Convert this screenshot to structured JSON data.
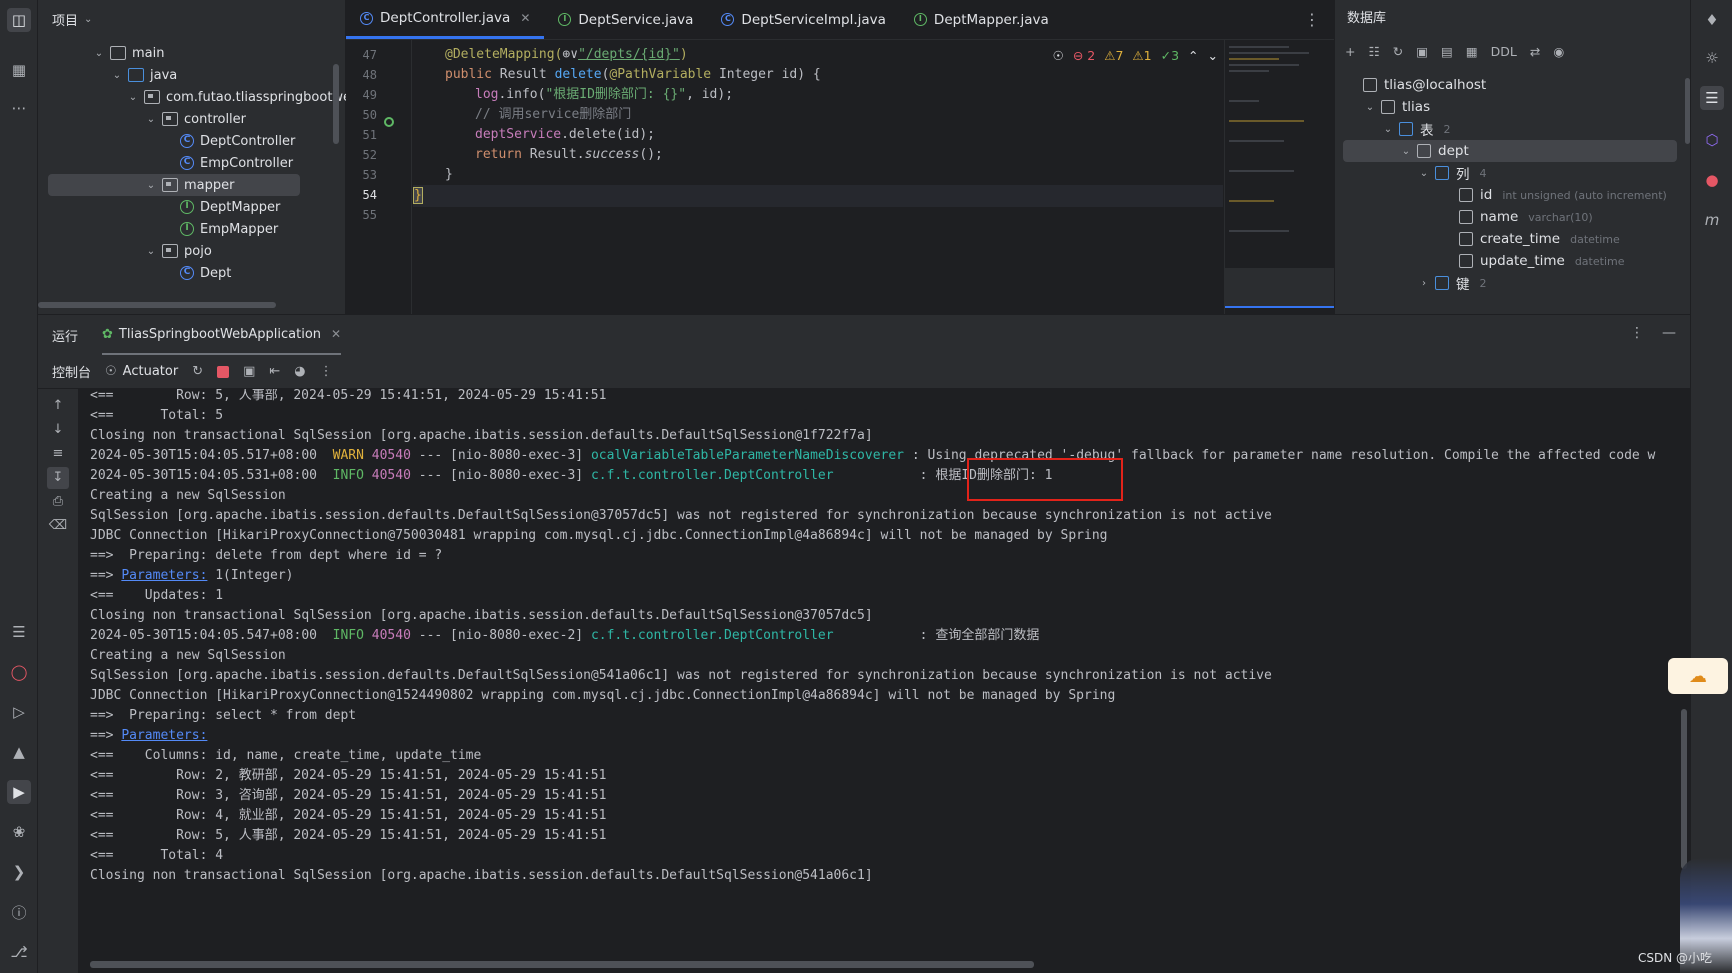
{
  "project": {
    "title": "项目",
    "tree": [
      {
        "label": "main",
        "depth": 0,
        "kind": "folder",
        "expanded": true
      },
      {
        "label": "java",
        "depth": 1,
        "kind": "folder-blue",
        "expanded": true
      },
      {
        "label": "com.futao.tliasspringbootwe",
        "depth": 2,
        "kind": "package",
        "expanded": true
      },
      {
        "label": "controller",
        "depth": 3,
        "kind": "package",
        "expanded": true
      },
      {
        "label": "DeptController",
        "depth": 4,
        "kind": "class"
      },
      {
        "label": "EmpController",
        "depth": 4,
        "kind": "class"
      },
      {
        "label": "mapper",
        "depth": 3,
        "kind": "package",
        "expanded": true,
        "selected": true
      },
      {
        "label": "DeptMapper",
        "depth": 4,
        "kind": "interface"
      },
      {
        "label": "EmpMapper",
        "depth": 4,
        "kind": "interface"
      },
      {
        "label": "pojo",
        "depth": 3,
        "kind": "package",
        "expanded": true
      },
      {
        "label": "Dept",
        "depth": 4,
        "kind": "class"
      }
    ]
  },
  "editor": {
    "tabs": [
      {
        "label": "DeptController.java",
        "kind": "class",
        "active": true
      },
      {
        "label": "DeptService.java",
        "kind": "interface"
      },
      {
        "label": "DeptServiceImpl.java",
        "kind": "class"
      },
      {
        "label": "DeptMapper.java",
        "kind": "interface"
      }
    ],
    "inspections": {
      "errors": "2",
      "warnings": "7",
      "weak_warnings": "1",
      "ok": "3"
    },
    "line_numbers": [
      "47",
      "48",
      "49",
      "50",
      "51",
      "52",
      "53",
      "54",
      "55"
    ],
    "code": {
      "l47_ann": "@DeleteMapping(",
      "l47_globe": "⊕∨",
      "l47_str": "\"/depts/{id}\"",
      "l47_end": ")",
      "l48_kw": "public ",
      "l48_type": "Result ",
      "l48_fn": "delete",
      "l48_open": "(",
      "l48_ann": "@PathVariable ",
      "l48_rest": "Integer id) {",
      "l49_field": "log",
      "l49_call": ".info(",
      "l49_str": "\"根据ID删除部门: {}\"",
      "l49_rest": ", id);",
      "l50_cmt": "// 调用service删除部门",
      "l51_field": "deptService",
      "l51_rest": ".delete(id);",
      "l52_kw": "return ",
      "l52_type": "Result.",
      "l52_ital": "success",
      "l52_rest": "();",
      "l53": "}",
      "l54": "}"
    }
  },
  "database": {
    "title": "数据库",
    "toolbar": [
      "+",
      "☷",
      "↻",
      "▣",
      "▤",
      "▦",
      "DDL",
      "⇄",
      "◉"
    ],
    "tree": [
      {
        "label": "tlias@localhost",
        "depth": 0
      },
      {
        "label": "tlias",
        "depth": 1,
        "expanded": true
      },
      {
        "label": "表",
        "depth": 2,
        "count": "2",
        "expanded": true
      },
      {
        "label": "dept",
        "depth": 3,
        "expanded": true,
        "selected": true
      },
      {
        "label": "列",
        "depth": 4,
        "count": "4",
        "expanded": true
      },
      {
        "label": "id",
        "depth": 5,
        "type": "int unsigned (auto increment)"
      },
      {
        "label": "name",
        "depth": 5,
        "type": "varchar(10)"
      },
      {
        "label": "create_time",
        "depth": 5,
        "type": "datetime"
      },
      {
        "label": "update_time",
        "depth": 5,
        "type": "datetime"
      },
      {
        "label": "键",
        "depth": 4,
        "count": "2",
        "expanded": false
      }
    ]
  },
  "run": {
    "title": "运行",
    "config": "TliasSpringbootWebApplication",
    "console_tab": "控制台",
    "actuator_tab": "Actuator"
  },
  "console": {
    "l1": "<==        Row: 5, 人事部, 2024-05-29 15:41:51, 2024-05-29 15:41:51",
    "l2": "<==      Total: 5",
    "l3": "Closing non transactional SqlSession [org.apache.ibatis.session.defaults.DefaultSqlSession@1f722f7a]",
    "l4_ts": "2024-05-30T15:04:05.517+08:00  ",
    "l4_level": "WARN ",
    "l4_pid": "40540",
    "l4_mid": " --- [nio-8080-exec-3] ",
    "l4_logger": "ocalVariableTableParameterNameDiscoverer",
    "l4_msg": " : Using deprecated '-debug' fallback for parameter name resolution. Compile the affected code w",
    "l5_ts": "2024-05-30T15:04:05.531+08:00  ",
    "l5_level": "INFO ",
    "l5_pid": "40540",
    "l5_mid": " --- [nio-8080-exec-3] ",
    "l5_logger": "c.f.t.controller.DeptController          ",
    "l5_msg": " : 根据ID删除部门: 1",
    "l6": "Creating a new SqlSession",
    "l7": "SqlSession [org.apache.ibatis.session.defaults.DefaultSqlSession@37057dc5] was not registered for synchronization because synchronization is not active",
    "l8": "JDBC Connection [HikariProxyConnection@750030481 wrapping com.mysql.cj.jdbc.ConnectionImpl@4a86894c] will not be managed by Spring",
    "l9": "==>  Preparing: delete from dept where id = ?",
    "l10_pre": "==> ",
    "l10_link": "Parameters:",
    "l10_rest": " 1(Integer)",
    "l11": "<==    Updates: 1",
    "l12": "Closing non transactional SqlSession [org.apache.ibatis.session.defaults.DefaultSqlSession@37057dc5]",
    "l13_ts": "2024-05-30T15:04:05.547+08:00  ",
    "l13_level": "INFO ",
    "l13_pid": "40540",
    "l13_mid": " --- [nio-8080-exec-2] ",
    "l13_logger": "c.f.t.controller.DeptController          ",
    "l13_msg": " : 查询全部部门数据",
    "l14": "Creating a new SqlSession",
    "l15": "SqlSession [org.apache.ibatis.session.defaults.DefaultSqlSession@541a06c1] was not registered for synchronization because synchronization is not active",
    "l16": "JDBC Connection [HikariProxyConnection@1524490802 wrapping com.mysql.cj.jdbc.ConnectionImpl@4a86894c] will not be managed by Spring",
    "l17": "==>  Preparing: select * from dept",
    "l18_pre": "==> ",
    "l18_link": "Parameters:",
    "l19": "<==    Columns: id, name, create_time, update_time",
    "l20": "<==        Row: 2, 教研部, 2024-05-29 15:41:51, 2024-05-29 15:41:51",
    "l21": "<==        Row: 3, 咨询部, 2024-05-29 15:41:51, 2024-05-29 15:41:51",
    "l22": "<==        Row: 4, 就业部, 2024-05-29 15:41:51, 2024-05-29 15:41:51",
    "l23": "<==        Row: 5, 人事部, 2024-05-29 15:41:51, 2024-05-29 15:41:51",
    "l24": "<==      Total: 4",
    "l25": "Closing non transactional SqlSession [org.apache.ibatis.session.defaults.DefaultSqlSession@541a06c1]"
  },
  "watermark": "CSDN @小吃",
  "colors": {
    "accent": "#3574f0",
    "highlight_box": "#e2231a",
    "warn": "#e0b13c",
    "info": "#5fb865"
  }
}
